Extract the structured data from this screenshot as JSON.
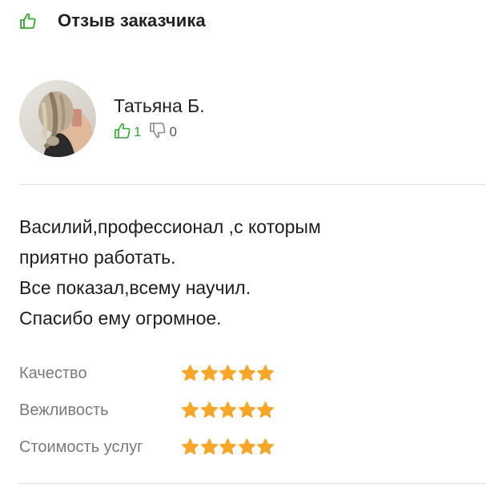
{
  "header": {
    "icon": "thumbs-up-icon",
    "title": "Отзыв заказчика"
  },
  "reviewer": {
    "avatar": "avatar-photo",
    "name": "Татьяна Б.",
    "likes": "1",
    "dislikes": "0",
    "like_icon": "thumbs-up-icon",
    "dislike_icon": "thumbs-down-icon"
  },
  "review": {
    "lines": [
      "Василий,профессионал ,с которым",
      "приятно работать.",
      "Все показал,всему научил.",
      "Спасибо ему огромное."
    ]
  },
  "ratings": [
    {
      "label": "Качество",
      "stars": 5,
      "max": 5
    },
    {
      "label": "Вежливость",
      "stars": 5,
      "max": 5
    },
    {
      "label": "Стоимость услуг",
      "stars": 5,
      "max": 5
    }
  ],
  "colors": {
    "accent_green": "#33a632",
    "star_orange": "#f7a62a",
    "label_gray": "#7a7a7a",
    "divider": "#dedede"
  }
}
